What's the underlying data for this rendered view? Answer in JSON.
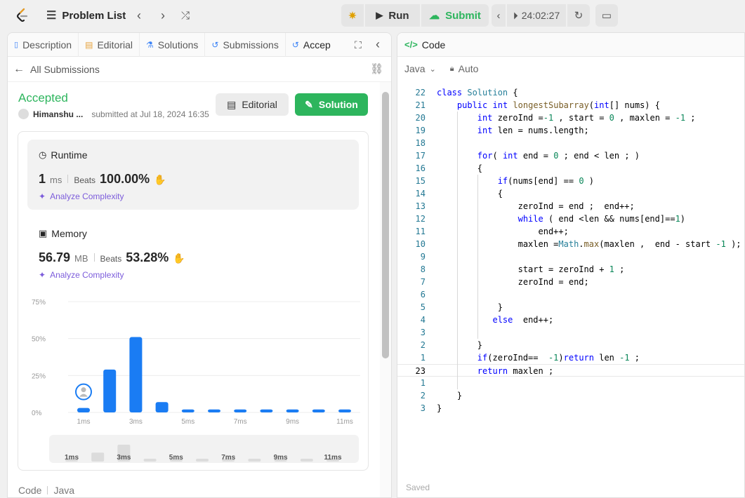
{
  "topbar": {
    "problem_list": "Problem List",
    "run_label": "Run",
    "submit_label": "Submit",
    "timer": "24:02:27"
  },
  "tabs": [
    {
      "label": "Description"
    },
    {
      "label": "Editorial"
    },
    {
      "label": "Solutions"
    },
    {
      "label": "Submissions"
    },
    {
      "label": "Accep"
    }
  ],
  "submission": {
    "back_label": "All Submissions",
    "status": "Accepted",
    "user": "Himanshu ...",
    "submitted_at": "submitted at Jul 18, 2024 16:35",
    "editorial_btn": "Editorial",
    "solution_btn": "Solution"
  },
  "runtime": {
    "title": "Runtime",
    "value": "1",
    "unit": "ms",
    "beats_label": "Beats",
    "beats": "100.00%",
    "analyze": "Analyze Complexity"
  },
  "memory": {
    "title": "Memory",
    "value": "56.79",
    "unit": "MB",
    "beats_label": "Beats",
    "beats": "53.28%",
    "analyze": "Analyze Complexity"
  },
  "chart_data": {
    "type": "bar",
    "categories": [
      "1ms",
      "2ms",
      "3ms",
      "4ms",
      "5ms",
      "6ms",
      "7ms",
      "8ms",
      "9ms",
      "10ms",
      "11ms"
    ],
    "x_tick_labels": [
      "1ms",
      "3ms",
      "5ms",
      "7ms",
      "9ms",
      "11ms"
    ],
    "y_tick_labels": [
      "75%",
      "50%",
      "25%",
      "0%"
    ],
    "values": [
      3,
      29,
      51,
      7,
      2,
      2,
      2,
      2,
      2,
      2,
      2
    ],
    "ylim": [
      0,
      75
    ],
    "grid": true,
    "bar_color": "#1a7cf3",
    "highlight_category": "1ms"
  },
  "mini_chart": {
    "values": [
      0,
      8,
      15,
      1,
      0,
      1,
      0,
      1,
      0,
      1,
      0
    ],
    "labels": [
      "1ms",
      "3ms",
      "5ms",
      "7ms",
      "9ms",
      "11ms"
    ]
  },
  "footer": {
    "code_label": "Code",
    "lang_label": "Java"
  },
  "editor": {
    "title": "Code",
    "language": "Java",
    "mode": "Auto",
    "saved": "Saved",
    "lines": [
      {
        "num": "22",
        "html": "<span class='kw'>class</span> <span class='ty'>Solution</span> {"
      },
      {
        "num": "21",
        "html": "    <span class='kw'>public</span> <span class='kw'>int</span> <span class='fn'>longestSubarray</span>(<span class='kw'>int</span>[] nums) {"
      },
      {
        "num": "20",
        "html": "        <span class='kw'>int</span> zeroInd =<span class='nm'>-1</span> , start = <span class='nm'>0</span> , maxlen = <span class='nm'>-1</span> ;"
      },
      {
        "num": "19",
        "html": "        <span class='kw'>int</span> len = nums.length;"
      },
      {
        "num": "18",
        "html": ""
      },
      {
        "num": "17",
        "html": "        <span class='kw'>for</span>( <span class='kw'>int</span> end = <span class='nm'>0</span> ; end &lt; len ; )"
      },
      {
        "num": "16",
        "html": "        {"
      },
      {
        "num": "15",
        "html": "            <span class='kw'>if</span>(nums[end] == <span class='nm'>0</span> )"
      },
      {
        "num": "14",
        "html": "            {"
      },
      {
        "num": "13",
        "html": "                zeroInd = end ;  end++;"
      },
      {
        "num": "12",
        "html": "                <span class='kw'>while</span> ( end &lt;len &amp;&amp; nums[end]==<span class='nm'>1</span>)"
      },
      {
        "num": "11",
        "html": "                    end++;"
      },
      {
        "num": "10",
        "html": "                maxlen =<span class='ty'>Math</span>.<span class='fn'>max</span>(maxlen ,  end - start <span class='nm'>-1</span> );"
      },
      {
        "num": "9",
        "html": ""
      },
      {
        "num": "8",
        "html": "                start = zeroInd + <span class='nm'>1</span> ;"
      },
      {
        "num": "7",
        "html": "                zeroInd = end;"
      },
      {
        "num": "6",
        "html": ""
      },
      {
        "num": "5",
        "html": "            }"
      },
      {
        "num": "4",
        "html": "           <span class='kw'>else</span>  end++;"
      },
      {
        "num": "3",
        "html": ""
      },
      {
        "num": "2",
        "html": "        }"
      },
      {
        "num": "1",
        "html": "        <span class='kw'>if</span>(zeroInd==  <span class='nm'>-1</span>)<span class='kw'>return</span> len <span class='nm'>-1</span> ;"
      },
      {
        "num": "23",
        "html": "        <span class='kw'>return</span> maxlen ;"
      },
      {
        "num": "1",
        "html": ""
      },
      {
        "num": "2",
        "html": "    }"
      },
      {
        "num": "3",
        "html": "}"
      }
    ]
  }
}
